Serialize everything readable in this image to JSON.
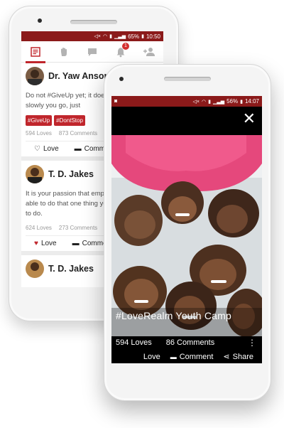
{
  "back_phone": {
    "status_bar": {
      "battery": "65%",
      "time": "10:50"
    },
    "nav_tabs": [
      {
        "icon": "feed-icon",
        "active": true
      },
      {
        "icon": "hand-icon",
        "active": false
      },
      {
        "icon": "chat-icon",
        "active": false
      },
      {
        "icon": "bell-icon",
        "active": false,
        "badge": "1"
      },
      {
        "icon": "add-user-icon",
        "active": false
      }
    ],
    "posts": [
      {
        "author": "Dr. Yaw Ansong Jnr",
        "text": "Do not #GiveUp yet; it does not matter how slowly you go, just",
        "tags": [
          "#GiveUp",
          "#DontStop"
        ],
        "loves": "594 Loves",
        "comments": "873 Comments",
        "love_label": "Love",
        "comment_label": "Comment"
      },
      {
        "author": "T. D. Jakes",
        "text": "It is your passion that empowers you to be able to do that one thing you were created to do.",
        "loves": "624 Loves",
        "comments": "273 Comments",
        "love_label": "Love",
        "comment_label": "Comment"
      },
      {
        "author": "T. D. Jakes"
      }
    ]
  },
  "front_phone": {
    "status_bar": {
      "battery": "56%",
      "time": "14:07"
    },
    "caption": "#LoveRealm Youth Camp",
    "loves": "594 Loves",
    "comments": "86 Comments",
    "actions": {
      "love": "Love",
      "comment": "Comment",
      "share": "Share"
    }
  },
  "colors": {
    "brand_red": "#c0262c",
    "status_red": "#8b1a1a"
  }
}
